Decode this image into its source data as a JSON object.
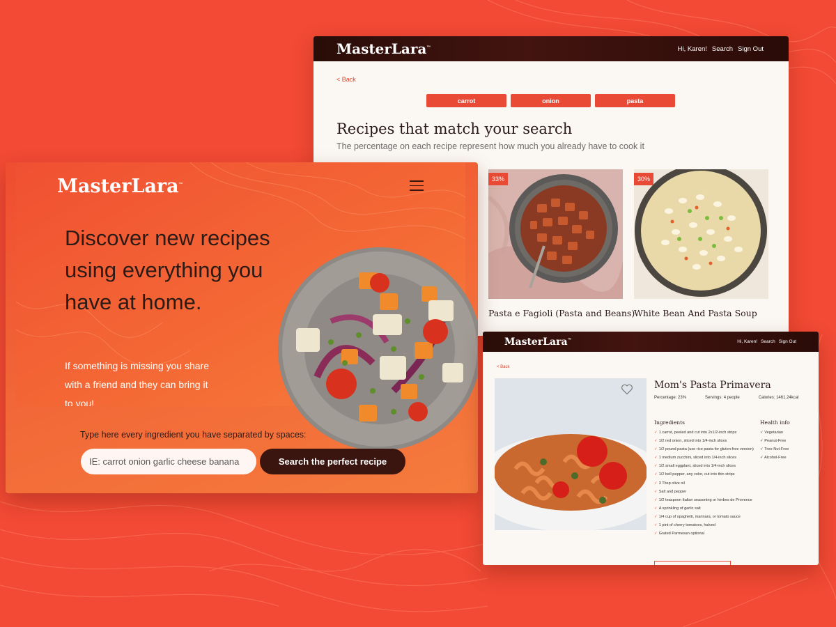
{
  "colors": {
    "background": "#f24a34",
    "accent": "#e84a36",
    "dark_header": "#2a0d08",
    "dark_button": "#3a140e",
    "card_bg": "#fbf8f3"
  },
  "results_page": {
    "brand": "MasterLara",
    "trademark": "™",
    "nav": [
      "Hi, Karen!",
      "Search",
      "Sign Out"
    ],
    "back_label": "< Back",
    "chips": [
      "carrot",
      "onion",
      "pasta"
    ],
    "title": "Recipes that match your search",
    "subtitle": "The percentage on each recipe represent how much you already have to cook it",
    "recipes": [
      {
        "badge": "33%",
        "name": "Pasta e Fagioli (Pasta and Beans)"
      },
      {
        "badge": "30%",
        "name": "White Bean And Pasta Soup"
      }
    ]
  },
  "landing_page": {
    "brand": "MasterLara",
    "trademark": "™",
    "menu_icon": "hamburger-menu-icon",
    "hero_title": "Discover new recipes using everything you have at home.",
    "hero_sub": "If something is missing you share with a friend and they can bring it to you!",
    "type_hint": "Type here every ingredient you have separated by spaces:",
    "input_placeholder": "IE: carrot onion garlic cheese banana",
    "search_button": "Search the perfect recipe"
  },
  "detail_page": {
    "brand": "MasterLara",
    "trademark": "™",
    "nav": [
      "Hi, Karen!",
      "Search",
      "Sign Out"
    ],
    "back_label": "< Back",
    "title": "Mom's Pasta Primavera",
    "favorite_icon": "heart-icon",
    "percentage": "Percentage: 23%",
    "servings": "Servings: 4 people",
    "calories": "Calories: 1461.24kcal",
    "ingredients_heading": "Ingredients",
    "ingredients": [
      "1 carrot, peeled and cut into 2x1/2-inch strips",
      "1/2 red onion, sliced into 1/4-inch slices",
      "1/2 pound pasta (use rice pasta for gluten-free version)",
      "1 medium zucchini, sliced into 1/4-inch slices",
      "1/2 small eggplant, sliced into 1/4-inch slices",
      "1/2 bell pepper, any color, cut into thin strips",
      "3 Tbsp olive oil",
      "Salt and pepper",
      "1/2 teaspoon Italian seasoning or herbes de Provence",
      "A sprinkling of garlic salt",
      "1/4 cup of spaghetti, marinara, or tomato sauce",
      "1 pint of cherry tomatoes, halved",
      "Grated Parmesan optional"
    ],
    "health_heading": "Health info",
    "health": [
      "Vegetarian",
      "Peanut-Free",
      "Tree-Nut-Free",
      "Alcohol-Free"
    ]
  }
}
